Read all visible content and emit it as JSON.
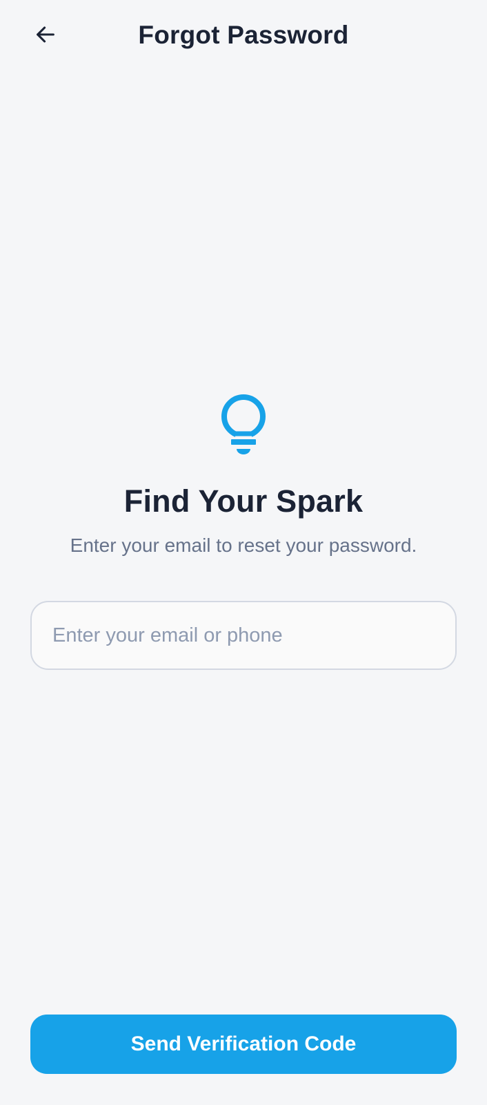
{
  "header": {
    "title": "Forgot Password",
    "back_icon": "arrow-left-icon"
  },
  "hero": {
    "icon": "lightbulb-icon",
    "title": "Find Your Spark",
    "subtitle": "Enter your email to reset your password."
  },
  "form": {
    "email_value": "",
    "email_placeholder": "Enter your email or phone"
  },
  "actions": {
    "send_label": "Send Verification Code"
  },
  "colors": {
    "accent": "#17a2e8",
    "text_primary": "#1b2335",
    "text_secondary": "#66728a",
    "background": "#f5f6f8"
  }
}
